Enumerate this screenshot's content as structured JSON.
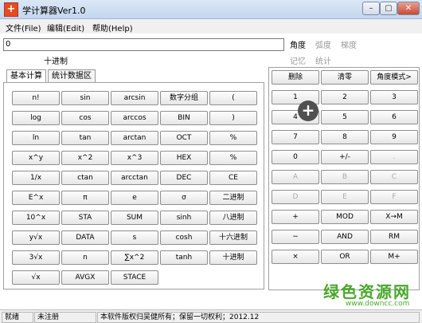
{
  "window": {
    "title": "学计算器Ver1.0",
    "min_glyph": "–",
    "max_glyph": "▢",
    "close_glyph": "✕"
  },
  "menu": {
    "file": "文件(File)",
    "edit": "编辑(Edit)",
    "help": "帮助(Help)"
  },
  "display": {
    "value": "0",
    "radix": "十进制"
  },
  "modes": {
    "degree": "角度",
    "radian": "弧度",
    "gradian": "梯度",
    "memory": "记忆",
    "stats": "统计"
  },
  "tabs": {
    "basic": "基本计算",
    "stats": "统计数据区"
  },
  "left_keys": [
    "n!",
    "sin",
    "arcsin",
    "数字分组",
    "(",
    "log",
    "cos",
    "arccos",
    "BIN",
    ")",
    "ln",
    "tan",
    "arctan",
    "OCT",
    "%",
    "x^y",
    "x^2",
    "x^3",
    "HEX",
    "%",
    "1/x",
    "ctan",
    "arcctan",
    "DEC",
    "CE",
    "E^x",
    "π",
    "e",
    "σ",
    "二进制",
    "10^x",
    "STA",
    "SUM",
    "sinh",
    "八进制",
    "y√x",
    "DATA",
    "s",
    "cosh",
    "十六进制",
    "3√x",
    "n",
    "∑x^2",
    "tanh",
    "十进制",
    "√x",
    "AVGX",
    "STACE"
  ],
  "right_keys": [
    "删除",
    "清零",
    "角度模式>",
    "1",
    "2",
    "3",
    "4",
    "5",
    "6",
    "7",
    "8",
    "9",
    "0",
    "+/-",
    ".",
    "A",
    "B",
    "C",
    "D",
    "E",
    "F",
    "+",
    "MOD",
    "X→M",
    "−",
    "AND",
    "RM",
    "×",
    "OR",
    "M+"
  ],
  "disabled_right_keys": [
    14,
    15,
    16,
    17,
    18,
    19,
    20
  ],
  "overlay": {
    "glyph": "+"
  },
  "status": {
    "ready": "就绪",
    "registration": "未注册",
    "copyright": "本软件版权归吴健所有；保留一切权利；2012.12"
  },
  "watermark": {
    "brand": "绿色资源网",
    "site": "www.downcc.com"
  }
}
